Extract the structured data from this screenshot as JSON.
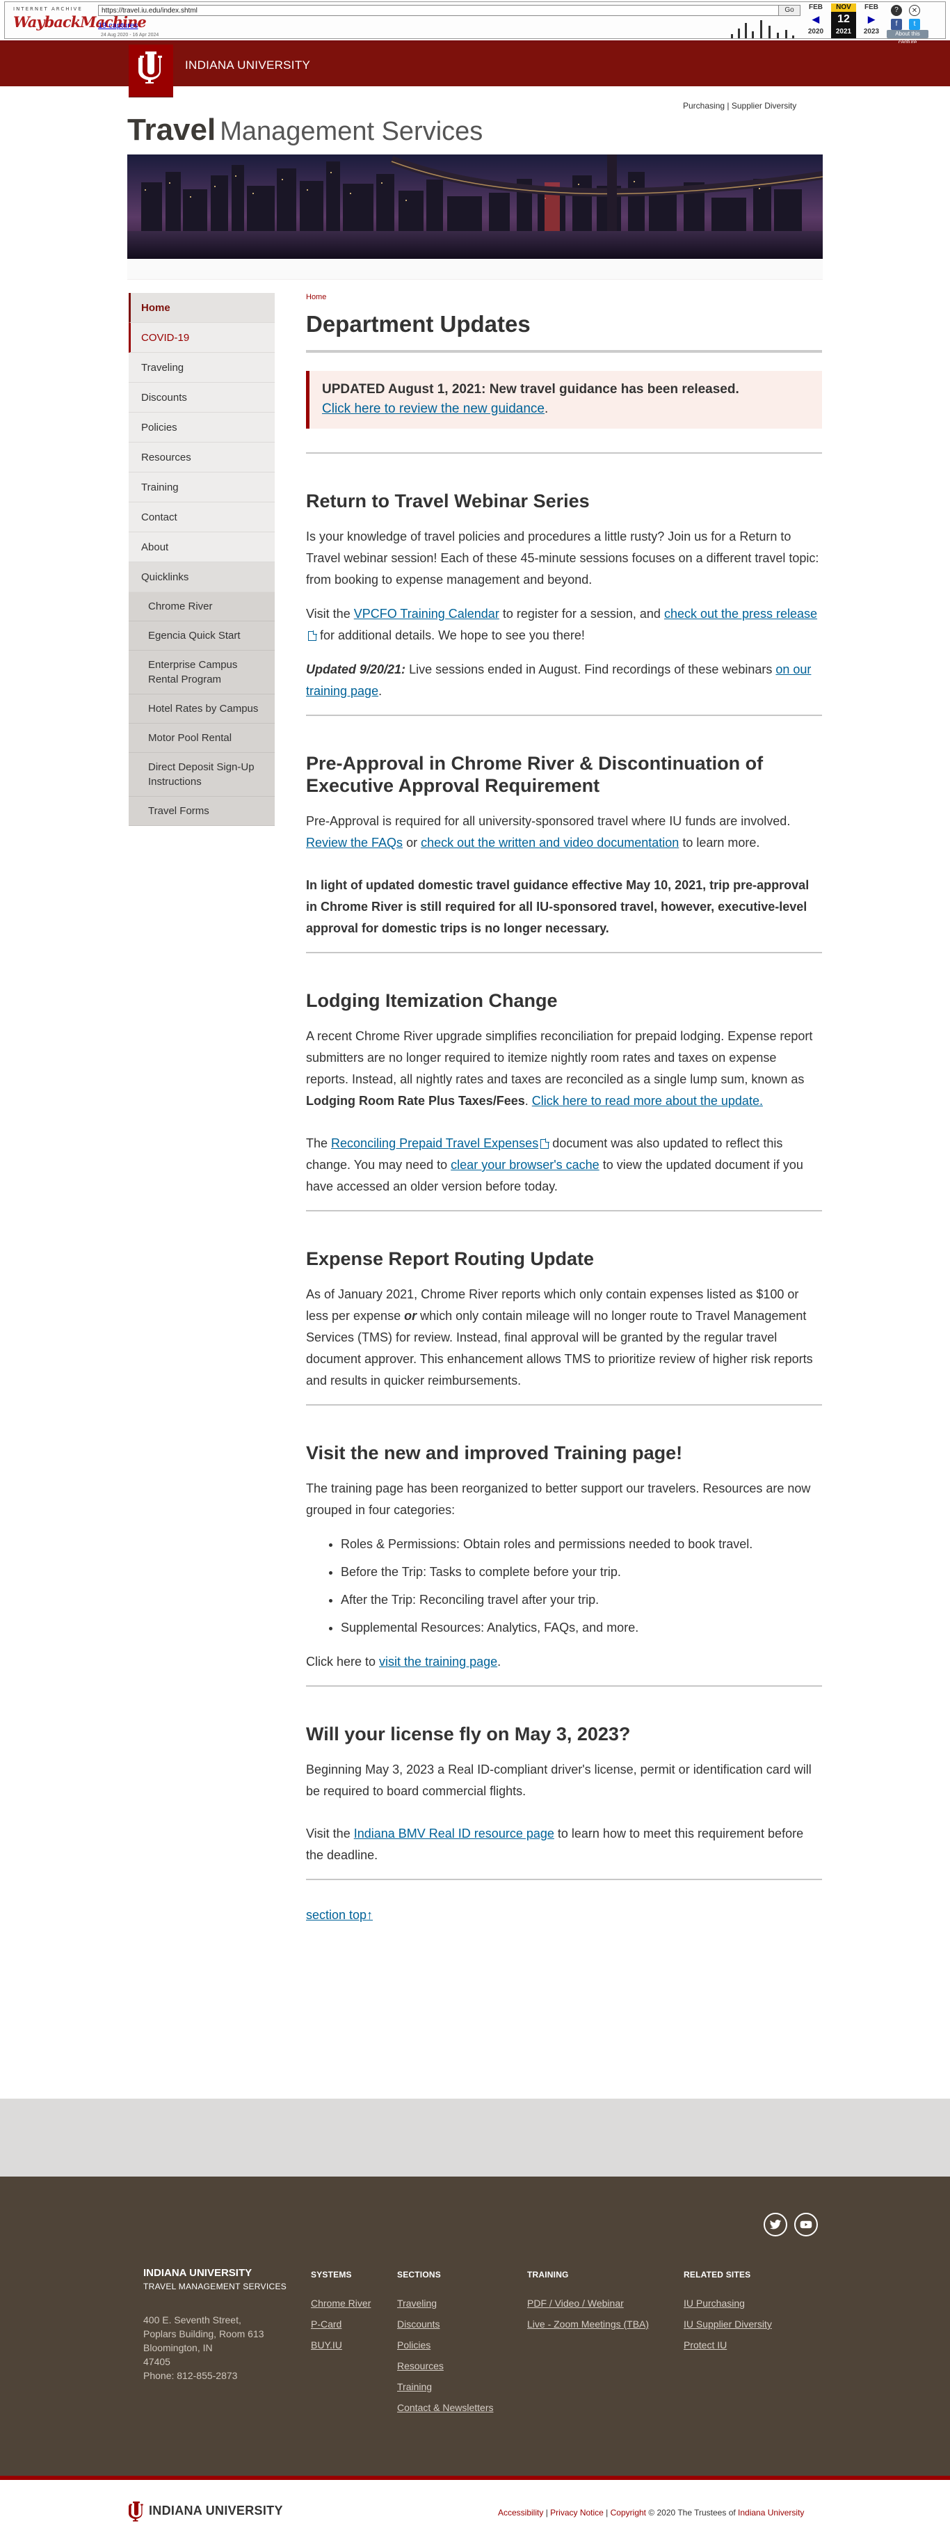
{
  "wayback": {
    "logo_top": "INTERNET ARCHIVE",
    "logo_main": "WaybackMachine",
    "url": "https://travel.iu.edu/index.shtml",
    "go": "Go",
    "captures": "19 captures",
    "range": "24 Aug 2020 - 16 Apr 2024",
    "months": [
      {
        "month": "FEB",
        "day": "",
        "year": "2020"
      },
      {
        "month": "NOV",
        "day": "12",
        "year": "2021"
      },
      {
        "month": "FEB",
        "day": "",
        "year": "2023"
      }
    ],
    "about": "About this capture"
  },
  "header": {
    "university": "INDIANA UNIVERSITY",
    "utility_links": [
      "Purchasing",
      "Supplier Diversity"
    ],
    "site_title_bold": "Travel",
    "site_title_rest": "Management Services"
  },
  "sidebar": {
    "items": [
      "Home",
      "COVID-19",
      "Traveling",
      "Discounts",
      "Policies",
      "Resources",
      "Training",
      "Contact",
      "About"
    ],
    "quicklinks_label": "Quicklinks",
    "quicklinks": [
      "Chrome River",
      "Egencia Quick Start",
      "Enterprise Campus Rental Program",
      "Hotel Rates by Campus",
      "Motor Pool Rental",
      "Direct Deposit Sign-Up Instructions",
      "Travel Forms"
    ]
  },
  "main": {
    "breadcrumb": "Home",
    "title": "Department Updates",
    "alert": {
      "bold": "UPDATED August 1, 2021: New travel guidance has been released.",
      "link": "Click here to review the new guidance",
      "after": "."
    },
    "webinar": {
      "heading": "Return to Travel Webinar Series",
      "p1": "Is your knowledge of travel policies and procedures a little rusty? Join us for a Return to Travel webinar session! Each of these 45-minute sessions focuses on a different travel topic: from booking to expense management and beyond.",
      "p2_a": "Visit the ",
      "p2_link1": "VPCFO Training Calendar",
      "p2_b": " to register for a session, and ",
      "p2_link2": "check out the press release",
      "p2_c": " for additional details. We hope to see you there!",
      "p3_em": "Updated 9/20/21:",
      "p3_text": "  Live sessions ended in August. Find recordings of these webinars ",
      "p3_link": "on our training page",
      "p3_end": "."
    },
    "preapproval": {
      "heading": "Pre-Approval in Chrome River & Discontinuation of Executive Approval Requirement",
      "p1_a": "Pre-Approval is required for all university-sponsored travel where IU funds are involved. ",
      "p1_link1": "Review the FAQs",
      "p1_b": " or ",
      "p1_link2": "check out the written and video documentation",
      "p1_c": " to learn more.",
      "p2": "In light of updated domestic travel guidance effective May 10, 2021, trip pre-approval in Chrome River is still required for all IU-sponsored travel, however, executive-level approval for domestic trips is no longer necessary."
    },
    "lodging": {
      "heading": "Lodging Itemization Change",
      "p1_a": "A recent Chrome River upgrade simplifies reconciliation for prepaid lodging. Expense report submitters are no longer required to itemize nightly room rates and taxes on expense reports. Instead, all nightly rates and taxes are reconciled as a single lump sum, known as ",
      "p1_bold": "Lodging Room Rate Plus Taxes/Fees",
      "p1_b": ". ",
      "p1_link": "Click here to read more about the update.",
      "p2_a": "The ",
      "p2_link1": "Reconciling Prepaid Travel Expenses",
      "p2_b": " document was also updated to reflect this change. You may need to ",
      "p2_link2": "clear your browser's cache",
      "p2_c": " to view the updated document if you have accessed an older version before today."
    },
    "routing": {
      "heading": "Expense Report Routing Update",
      "p1_a": "As of January 2021, Chrome River reports which only contain expenses listed as $100 or less per expense ",
      "p1_em": "or",
      "p1_b": " which only contain mileage will no longer route to Travel Management Services (TMS) for review. Instead, final approval will be granted by the regular travel document approver. This enhancement allows TMS to prioritize review of higher risk reports and results in quicker reimbursements."
    },
    "training": {
      "heading": "Visit the new and improved Training page!",
      "p1": "The training page has been reorganized to better support our travelers. Resources are now grouped in four categories:",
      "bullets": [
        "Roles & Permissions: Obtain roles and permissions needed to book travel.",
        "Before the Trip: Tasks to complete before your trip.",
        "After the Trip: Reconciling travel after your trip.",
        "Supplemental Resources: Analytics, FAQs, and more."
      ],
      "p2_a": "Click here to ",
      "p2_link": "visit the training page",
      "p2_b": "."
    },
    "license": {
      "heading": "Will your license fly on May 3, 2023?",
      "p1": "Beginning May 3, 2023 a Real ID-compliant driver's license, permit or identification card will be required to board commercial flights.",
      "p2_a": "Visit the ",
      "p2_link": "Indiana BMV Real ID resource page",
      "p2_b": " to learn how to meet this requirement before the deadline."
    },
    "top_link": "section top"
  },
  "footer": {
    "org": "INDIANA UNIVERSITY",
    "dept": "TRAVEL MANAGEMENT SERVICES",
    "address": [
      "400 E. Seventh Street,",
      "Poplars Building, Room 613",
      "Bloomington, IN",
      "47405",
      "Phone: 812-855-2873"
    ],
    "columns": [
      {
        "heading": "Systems",
        "links": [
          "Chrome River",
          "P-Card",
          "BUY.IU"
        ]
      },
      {
        "heading": "Sections",
        "links": [
          "Traveling",
          "Discounts",
          "Policies",
          "Resources",
          "Training",
          "Contact & Newsletters"
        ]
      },
      {
        "heading": "Training",
        "links": [
          "PDF / Video / Webinar",
          "Live - Zoom Meetings (TBA)"
        ]
      },
      {
        "heading": "Related Sites",
        "links": [
          "IU Purchasing",
          "IU Supplier Diversity",
          "Protect IU"
        ]
      }
    ]
  },
  "bottom": {
    "name": "INDIANA UNIVERSITY",
    "accessibility": "Accessibility",
    "privacy": "Privacy Notice",
    "copyright": "Copyright",
    "copyright_text": " © 2020 The Trustees of ",
    "copyright_link": "Indiana University"
  }
}
